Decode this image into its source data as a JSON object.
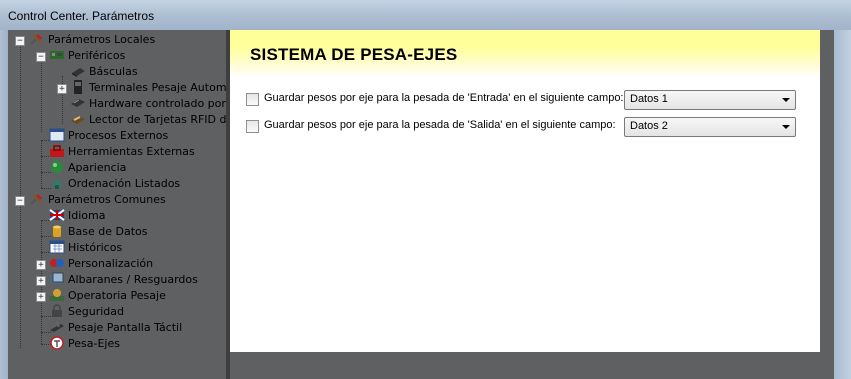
{
  "window": {
    "title": "Control Center. Parámetros"
  },
  "tree": {
    "items": [
      {
        "label": "Parámetros Locales",
        "icon": "tools-icon"
      },
      {
        "label": "Periféricos",
        "icon": "board-icon"
      },
      {
        "label": "Básculas",
        "icon": "scale-icon"
      },
      {
        "label": "Terminales Pesaje Automático",
        "icon": "terminal-icon"
      },
      {
        "label": "Hardware controlado por PLC",
        "icon": "hardware-icon"
      },
      {
        "label": "Lector de Tarjetas RFID de",
        "icon": "card-reader-icon"
      },
      {
        "label": "Procesos Externos",
        "icon": "window-icon"
      },
      {
        "label": "Herramientas Externas",
        "icon": "toolbox-icon"
      },
      {
        "label": "Apariencia",
        "icon": "appearance-icon"
      },
      {
        "label": "Ordenación Listados",
        "icon": "list-sort-icon"
      },
      {
        "label": "Parámetros Comunes",
        "icon": "tools-icon"
      },
      {
        "label": "Idioma",
        "icon": "flag-icon"
      },
      {
        "label": "Base de Datos",
        "icon": "database-icon"
      },
      {
        "label": "Históricos",
        "icon": "calendar-icon"
      },
      {
        "label": "Personalización",
        "icon": "personalization-icon"
      },
      {
        "label": "Albaranes / Resguardos",
        "icon": "documents-icon"
      },
      {
        "label": "Operatoria Pesaje",
        "icon": "weighing-icon"
      },
      {
        "label": "Seguridad",
        "icon": "lock-icon"
      },
      {
        "label": "Pesaje Pantalla Táctil",
        "icon": "touch-icon"
      },
      {
        "label": "Pesa-Ejes",
        "icon": "axle-scale-icon"
      }
    ]
  },
  "panel": {
    "title": "SISTEMA DE PESA-EJES",
    "options": [
      {
        "label": "Guardar pesos por eje para la pesada de 'Entrada' en el siguiente campo:",
        "checked": false,
        "select_value": "Datos 1"
      },
      {
        "label": "Guardar pesos por eje para la pesada de 'Salida' en el siguiente campo:",
        "checked": false,
        "select_value": "Datos 2"
      }
    ]
  }
}
